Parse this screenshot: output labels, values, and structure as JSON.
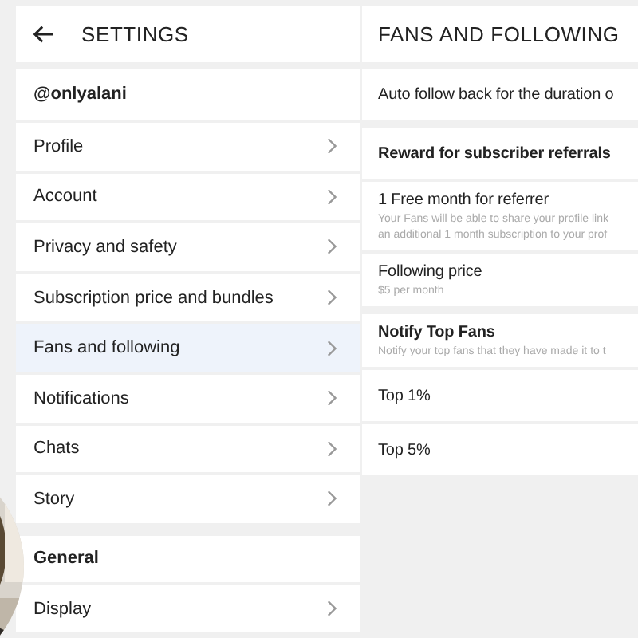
{
  "settings": {
    "title": "SETTINGS",
    "username": "@onlyalani",
    "items": [
      {
        "label": "Profile",
        "selected": false
      },
      {
        "label": "Account",
        "selected": false
      },
      {
        "label": "Privacy and safety",
        "selected": false
      },
      {
        "label": "Subscription price and bundles",
        "selected": false
      },
      {
        "label": "Fans and following",
        "selected": true
      },
      {
        "label": "Notifications",
        "selected": false
      },
      {
        "label": "Chats",
        "selected": false
      },
      {
        "label": "Story",
        "selected": false
      }
    ],
    "sections": [
      {
        "heading": "General",
        "items": [
          {
            "label": "Display",
            "selected": false
          }
        ]
      }
    ]
  },
  "detail": {
    "title": "FANS AND FOLLOWING",
    "rows": [
      {
        "kind": "option",
        "label": "Auto follow back for the duration o"
      },
      {
        "kind": "heading",
        "label": "Reward for subscriber referrals"
      },
      {
        "kind": "option",
        "label": "1 Free month for referrer",
        "description": [
          "Your Fans will be able to share your profile link",
          "an additional 1 month subscription to your prof"
        ]
      },
      {
        "kind": "option",
        "label": "Following price",
        "description": [
          "$5 per month"
        ]
      },
      {
        "kind": "heading",
        "label": "Notify Top Fans",
        "description": [
          "Notify your top fans that they have made it to t"
        ]
      },
      {
        "kind": "option",
        "label": "Top 1%"
      },
      {
        "kind": "option",
        "label": "Top 5%"
      }
    ]
  }
}
